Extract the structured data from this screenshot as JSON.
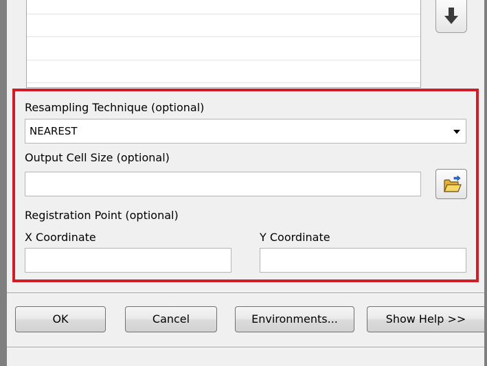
{
  "resampling": {
    "label": "Resampling Technique (optional)",
    "selected": "NEAREST"
  },
  "output_cell_size": {
    "label": "Output Cell Size (optional)",
    "value": ""
  },
  "registration_point": {
    "label": "Registration Point (optional)",
    "x_label": "X Coordinate",
    "y_label": "Y Coordinate",
    "x_value": "",
    "y_value": ""
  },
  "buttons": {
    "ok": "OK",
    "cancel": "Cancel",
    "environments": "Environments...",
    "show_help": "Show Help >>"
  },
  "colors": {
    "highlight_frame": "#d01c24",
    "dialog_bg": "#f0f0f0",
    "window_border": "#7f7f7f"
  },
  "icons": {
    "move_down": "arrow-down-icon",
    "browse": "folder-open-icon",
    "dropdown": "chevron-down-icon"
  }
}
